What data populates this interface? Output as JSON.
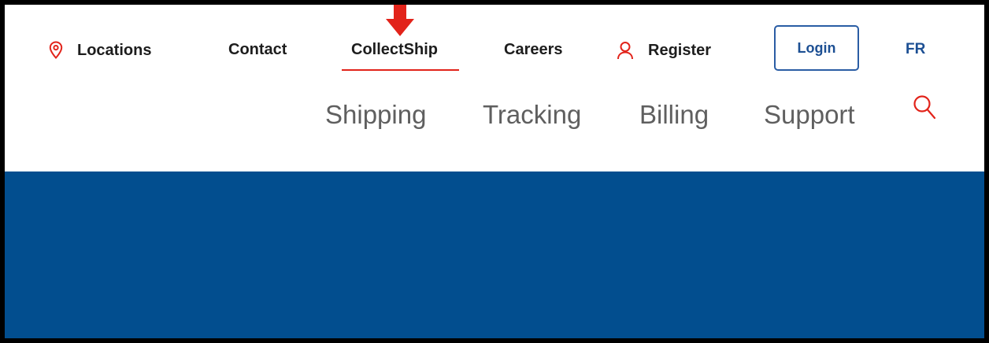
{
  "utility_nav": {
    "locations_label": "Locations",
    "contact_label": "Contact",
    "collectship_label": "CollectShip",
    "careers_label": "Careers",
    "register_label": "Register",
    "login_label": "Login",
    "language_label": "FR"
  },
  "main_nav": {
    "items": [
      "Shipping",
      "Tracking",
      "Billing",
      "Support"
    ]
  },
  "icons": {
    "locations": "map-pin-icon",
    "register": "user-icon",
    "search": "search-icon",
    "annotation": "red-down-arrow"
  },
  "colors": {
    "accent_red": "#e2231a",
    "brand_blue": "#024e8f",
    "link_blue": "#1c4f93"
  }
}
